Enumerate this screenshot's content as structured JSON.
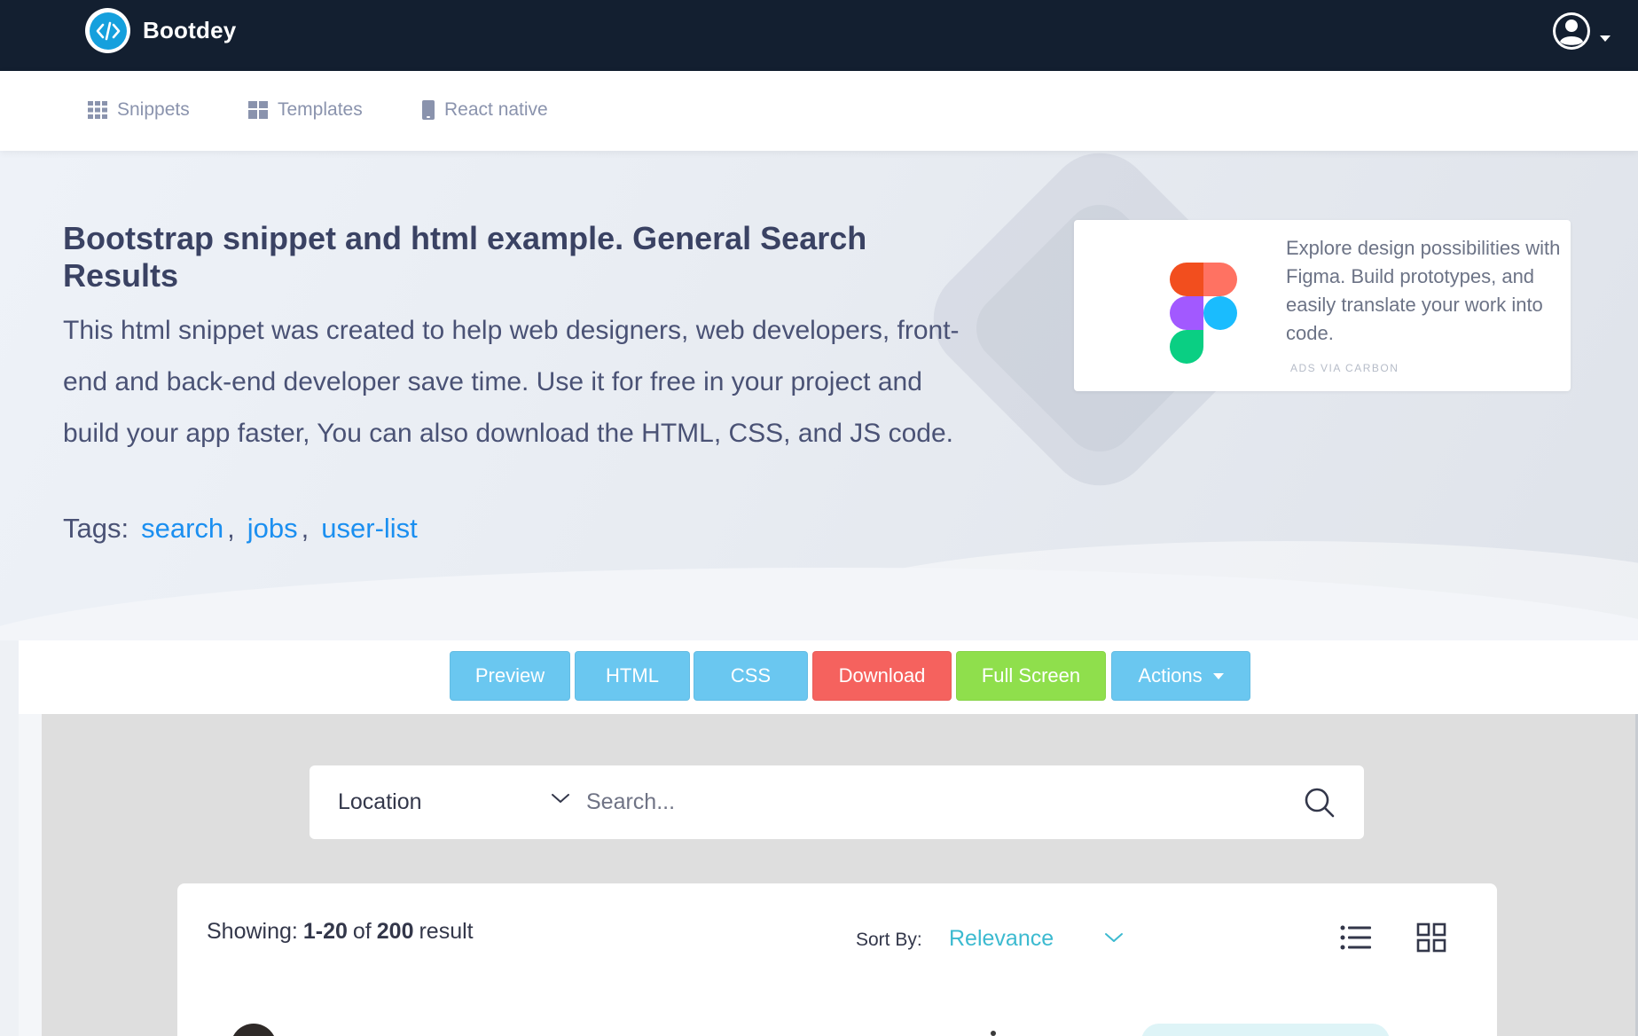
{
  "navbar": {
    "brand_name": "Bootdey",
    "brand_icon": "code-icon",
    "user_icon": "user-circle-icon"
  },
  "subnav": {
    "items": [
      {
        "label": "Snippets",
        "icon": "grid-icon"
      },
      {
        "label": "Templates",
        "icon": "layout-icon"
      },
      {
        "label": "React native",
        "icon": "mobile-icon"
      }
    ]
  },
  "hero": {
    "title": "Bootstrap snippet and html example. General Search Results",
    "description": "This html snippet was created to help web designers, web developers, front-end and back-end developer save time. Use it for free in your project and build your app faster, You can also download the HTML, CSS, and JS code.",
    "tags_label": "Tags:",
    "tags": [
      "search",
      "jobs",
      "user-list"
    ],
    "tag_separator": ","
  },
  "ad": {
    "text": "Explore design possibilities with Figma. Build prototypes, and easily translate your work into code.",
    "via": "ADS VIA CARBON",
    "image": "figma-logo"
  },
  "toolbar": {
    "preview": "Preview",
    "html": "HTML",
    "css": "CSS",
    "download": "Download",
    "fullscreen": "Full Screen",
    "actions": "Actions"
  },
  "search": {
    "location_value": "Location",
    "placeholder": "Search..."
  },
  "results": {
    "showing_label": "Showing:",
    "range": "1-20",
    "of_label": "of",
    "total": "200",
    "result_label": "result",
    "sort_label": "Sort By:",
    "sort_value": "Relevance"
  },
  "colors": {
    "navbar_bg": "#131f30",
    "brand_blue": "#15a0dd",
    "btn_info": "#6ac7f0",
    "btn_danger": "#f5625e",
    "btn_success": "#8fdf4c",
    "link": "#1b8ff0",
    "sort_accent": "#3cbad0"
  }
}
